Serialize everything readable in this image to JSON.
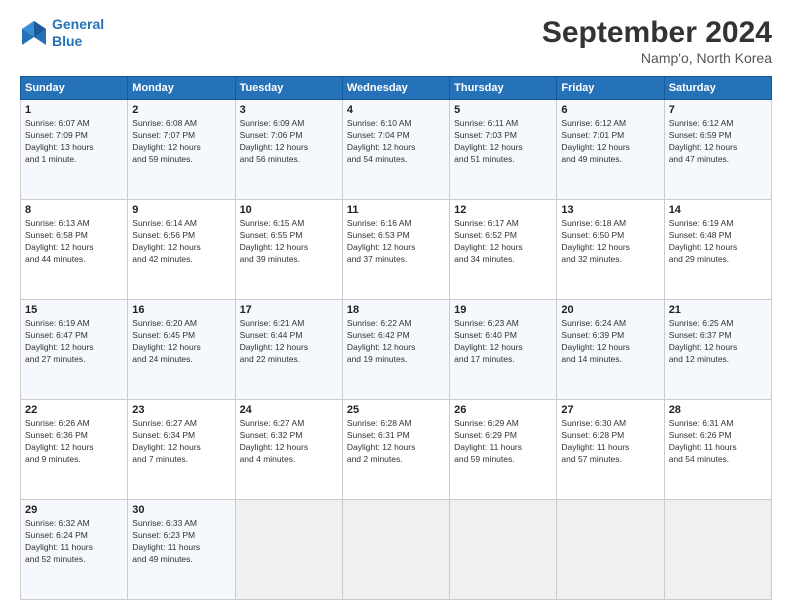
{
  "header": {
    "logo_line1": "General",
    "logo_line2": "Blue",
    "main_title": "September 2024",
    "subtitle": "Namp'o, North Korea"
  },
  "weekdays": [
    "Sunday",
    "Monday",
    "Tuesday",
    "Wednesday",
    "Thursday",
    "Friday",
    "Saturday"
  ],
  "weeks": [
    [
      {
        "day": "1",
        "info": "Sunrise: 6:07 AM\nSunset: 7:09 PM\nDaylight: 13 hours\nand 1 minute."
      },
      {
        "day": "2",
        "info": "Sunrise: 6:08 AM\nSunset: 7:07 PM\nDaylight: 12 hours\nand 59 minutes."
      },
      {
        "day": "3",
        "info": "Sunrise: 6:09 AM\nSunset: 7:06 PM\nDaylight: 12 hours\nand 56 minutes."
      },
      {
        "day": "4",
        "info": "Sunrise: 6:10 AM\nSunset: 7:04 PM\nDaylight: 12 hours\nand 54 minutes."
      },
      {
        "day": "5",
        "info": "Sunrise: 6:11 AM\nSunset: 7:03 PM\nDaylight: 12 hours\nand 51 minutes."
      },
      {
        "day": "6",
        "info": "Sunrise: 6:12 AM\nSunset: 7:01 PM\nDaylight: 12 hours\nand 49 minutes."
      },
      {
        "day": "7",
        "info": "Sunrise: 6:12 AM\nSunset: 6:59 PM\nDaylight: 12 hours\nand 47 minutes."
      }
    ],
    [
      {
        "day": "8",
        "info": "Sunrise: 6:13 AM\nSunset: 6:58 PM\nDaylight: 12 hours\nand 44 minutes."
      },
      {
        "day": "9",
        "info": "Sunrise: 6:14 AM\nSunset: 6:56 PM\nDaylight: 12 hours\nand 42 minutes."
      },
      {
        "day": "10",
        "info": "Sunrise: 6:15 AM\nSunset: 6:55 PM\nDaylight: 12 hours\nand 39 minutes."
      },
      {
        "day": "11",
        "info": "Sunrise: 6:16 AM\nSunset: 6:53 PM\nDaylight: 12 hours\nand 37 minutes."
      },
      {
        "day": "12",
        "info": "Sunrise: 6:17 AM\nSunset: 6:52 PM\nDaylight: 12 hours\nand 34 minutes."
      },
      {
        "day": "13",
        "info": "Sunrise: 6:18 AM\nSunset: 6:50 PM\nDaylight: 12 hours\nand 32 minutes."
      },
      {
        "day": "14",
        "info": "Sunrise: 6:19 AM\nSunset: 6:48 PM\nDaylight: 12 hours\nand 29 minutes."
      }
    ],
    [
      {
        "day": "15",
        "info": "Sunrise: 6:19 AM\nSunset: 6:47 PM\nDaylight: 12 hours\nand 27 minutes."
      },
      {
        "day": "16",
        "info": "Sunrise: 6:20 AM\nSunset: 6:45 PM\nDaylight: 12 hours\nand 24 minutes."
      },
      {
        "day": "17",
        "info": "Sunrise: 6:21 AM\nSunset: 6:44 PM\nDaylight: 12 hours\nand 22 minutes."
      },
      {
        "day": "18",
        "info": "Sunrise: 6:22 AM\nSunset: 6:42 PM\nDaylight: 12 hours\nand 19 minutes."
      },
      {
        "day": "19",
        "info": "Sunrise: 6:23 AM\nSunset: 6:40 PM\nDaylight: 12 hours\nand 17 minutes."
      },
      {
        "day": "20",
        "info": "Sunrise: 6:24 AM\nSunset: 6:39 PM\nDaylight: 12 hours\nand 14 minutes."
      },
      {
        "day": "21",
        "info": "Sunrise: 6:25 AM\nSunset: 6:37 PM\nDaylight: 12 hours\nand 12 minutes."
      }
    ],
    [
      {
        "day": "22",
        "info": "Sunrise: 6:26 AM\nSunset: 6:36 PM\nDaylight: 12 hours\nand 9 minutes."
      },
      {
        "day": "23",
        "info": "Sunrise: 6:27 AM\nSunset: 6:34 PM\nDaylight: 12 hours\nand 7 minutes."
      },
      {
        "day": "24",
        "info": "Sunrise: 6:27 AM\nSunset: 6:32 PM\nDaylight: 12 hours\nand 4 minutes."
      },
      {
        "day": "25",
        "info": "Sunrise: 6:28 AM\nSunset: 6:31 PM\nDaylight: 12 hours\nand 2 minutes."
      },
      {
        "day": "26",
        "info": "Sunrise: 6:29 AM\nSunset: 6:29 PM\nDaylight: 11 hours\nand 59 minutes."
      },
      {
        "day": "27",
        "info": "Sunrise: 6:30 AM\nSunset: 6:28 PM\nDaylight: 11 hours\nand 57 minutes."
      },
      {
        "day": "28",
        "info": "Sunrise: 6:31 AM\nSunset: 6:26 PM\nDaylight: 11 hours\nand 54 minutes."
      }
    ],
    [
      {
        "day": "29",
        "info": "Sunrise: 6:32 AM\nSunset: 6:24 PM\nDaylight: 11 hours\nand 52 minutes."
      },
      {
        "day": "30",
        "info": "Sunrise: 6:33 AM\nSunset: 6:23 PM\nDaylight: 11 hours\nand 49 minutes."
      },
      {
        "day": "",
        "info": ""
      },
      {
        "day": "",
        "info": ""
      },
      {
        "day": "",
        "info": ""
      },
      {
        "day": "",
        "info": ""
      },
      {
        "day": "",
        "info": ""
      }
    ]
  ]
}
